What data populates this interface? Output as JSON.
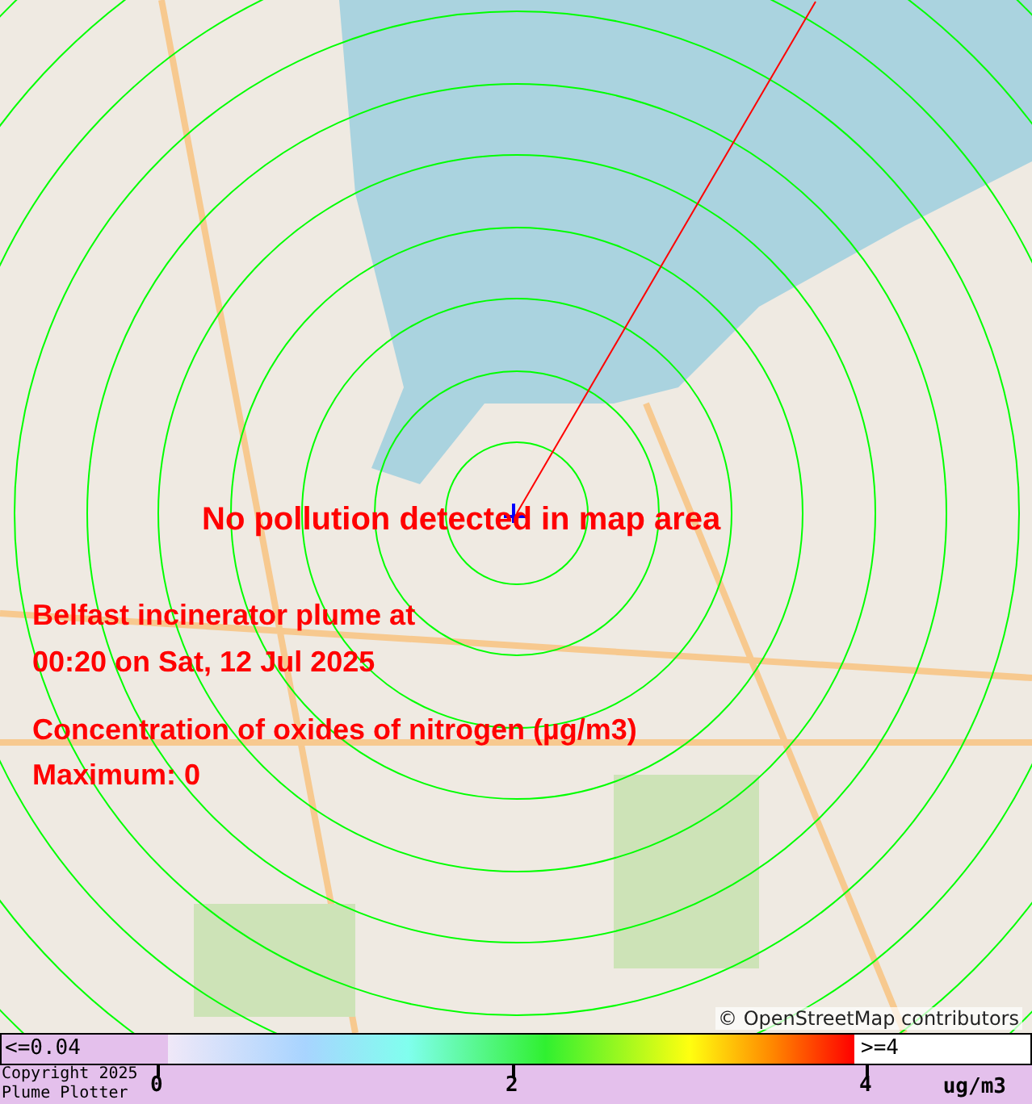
{
  "map": {
    "status_message": "No pollution detected in map area",
    "title_lines": [
      "Belfast incinerator plume at",
      "00:20 on Sat, 12 Jul 2025"
    ],
    "pollutant": "Concentration of oxides of nitrogen (µg/m3)",
    "maximum": "Maximum: 0",
    "attribution": "© OpenStreetMap contributors"
  },
  "legend": {
    "below_label": "<=0.04",
    "above_label": ">=4",
    "ticks": [
      "0",
      "2",
      "4"
    ],
    "unit": "ug/m3",
    "copyright_lines": [
      "Copyright 2025",
      "Plume Plotter"
    ]
  }
}
